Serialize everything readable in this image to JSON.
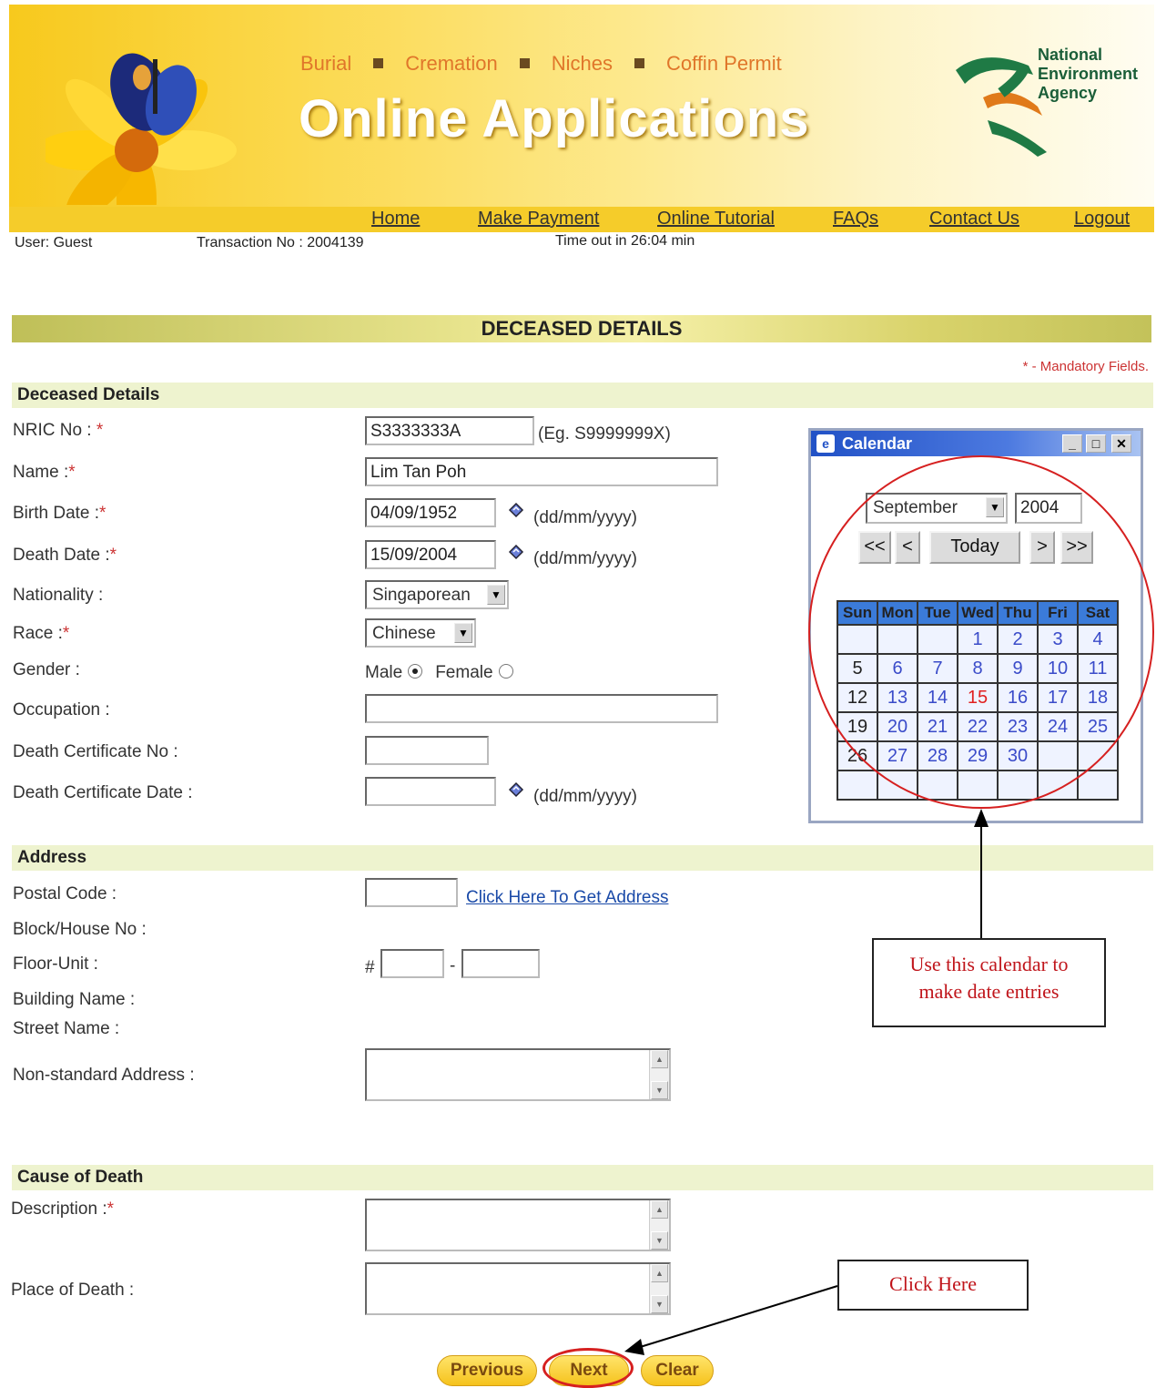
{
  "banner": {
    "topics": [
      "Burial",
      "Cremation",
      "Niches",
      "Coffin Permit"
    ],
    "title": "Online Applications",
    "agency": [
      "National",
      "Environment",
      "Agency"
    ]
  },
  "nav": {
    "home": "Home",
    "make_payment": "Make Payment",
    "online_tutorial": "Online Tutorial",
    "faqs": "FAQs",
    "contact_us": "Contact Us",
    "logout": "Logout"
  },
  "status": {
    "user": "User: Guest",
    "transaction": "Transaction No : 2004139",
    "timeout": "Time out in 26:04 min"
  },
  "page_title": "DECEASED DETAILS",
  "mandatory_note": "* - Mandatory Fields.",
  "sections": {
    "deceased": "Deceased Details",
    "address": "Address",
    "cause": "Cause of Death"
  },
  "labels": {
    "nric": "NRIC No :",
    "name": "Name :",
    "birth_date": "Birth Date :",
    "death_date": "Death Date :",
    "nationality": "Nationality :",
    "race": "Race :",
    "gender": "Gender :",
    "occupation": "Occupation :",
    "death_cert_no": "Death Certificate No :",
    "death_cert_date": "Death Certificate Date :",
    "postal_code": "Postal Code :",
    "block": "Block/House No :",
    "floor_unit": "Floor-Unit :",
    "building": "Building Name :",
    "street": "Street Name :",
    "non_standard": "Non-standard Address :",
    "description": "Description :",
    "place_of_death": "Place of Death :"
  },
  "values": {
    "nric": "S3333333A",
    "name": "Lim Tan Poh",
    "birth_date": "04/09/1952",
    "death_date": "15/09/2004",
    "nationality": "Singaporean",
    "race": "Chinese",
    "gender_male": "Male",
    "gender_female": "Female"
  },
  "hints": {
    "nric": "(Eg. S9999999X)",
    "date": "(dd/mm/yyyy)",
    "get_address": "Click Here To Get Address",
    "hash": "#",
    "dash": "-"
  },
  "calendar": {
    "title": "Calendar",
    "month": "September",
    "year": "2004",
    "prev_year": "<<",
    "prev_month": "<",
    "today": "Today",
    "next_month": ">",
    "next_year": ">>",
    "days": [
      "Sun",
      "Mon",
      "Tue",
      "Wed",
      "Thu",
      "Fri",
      "Sat"
    ],
    "weeks": [
      [
        "",
        "",
        "",
        "1",
        "2",
        "3",
        "4"
      ],
      [
        "5",
        "6",
        "7",
        "8",
        "9",
        "10",
        "11"
      ],
      [
        "12",
        "13",
        "14",
        "15",
        "16",
        "17",
        "18"
      ],
      [
        "19",
        "20",
        "21",
        "22",
        "23",
        "24",
        "25"
      ],
      [
        "26",
        "27",
        "28",
        "29",
        "30",
        "",
        ""
      ],
      [
        "",
        "",
        "",
        "",
        "",
        "",
        ""
      ]
    ],
    "highlight": "15"
  },
  "callouts": {
    "calendar_line1": "Use this calendar to",
    "calendar_line2": "make date entries",
    "click_here": "Click Here"
  },
  "buttons": {
    "previous": "Previous",
    "next": "Next",
    "clear": "Clear"
  }
}
